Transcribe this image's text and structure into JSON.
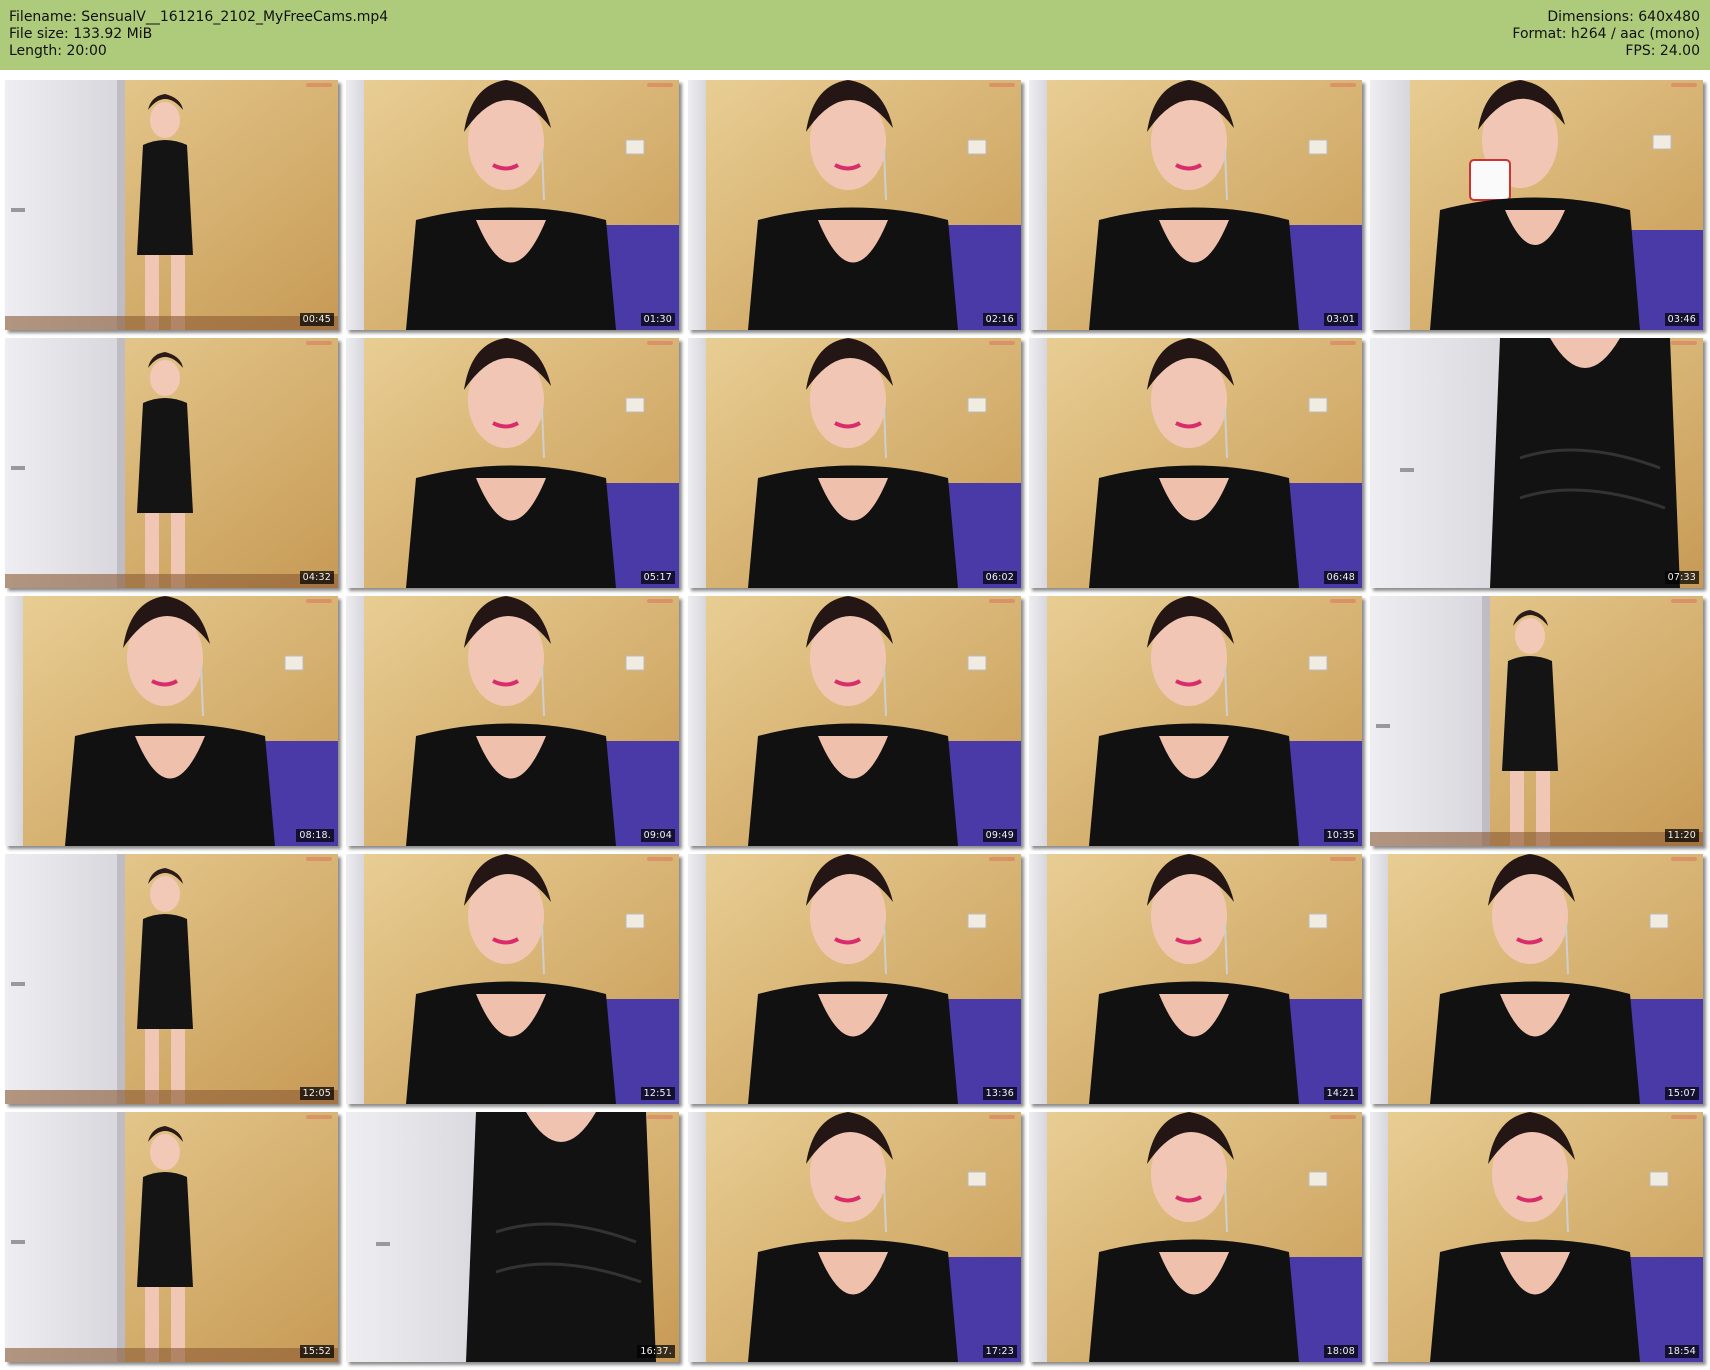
{
  "header": {
    "filename": "Filename: SensualV__161216_2102_MyFreeCams.mp4",
    "filesize": "File size: 133.92 MiB",
    "length": "Length: 20:00",
    "dimensions": "Dimensions: 640x480",
    "format": "Format: h264 / aac (mono)",
    "fps": "FPS: 24.00",
    "background_color": "#aecb7c"
  },
  "thumbnails": [
    {
      "timestamp": "00:45",
      "scene": "door-full"
    },
    {
      "timestamp": "01:30",
      "scene": "closeup-sofa"
    },
    {
      "timestamp": "02:16",
      "scene": "closeup-sofa"
    },
    {
      "timestamp": "03:01",
      "scene": "closeup-sofa"
    },
    {
      "timestamp": "03:46",
      "scene": "closeup-mug"
    },
    {
      "timestamp": "04:32",
      "scene": "door-full"
    },
    {
      "timestamp": "05:17",
      "scene": "closeup-sofa"
    },
    {
      "timestamp": "06:02",
      "scene": "closeup-sofa"
    },
    {
      "timestamp": "06:48",
      "scene": "closeup-sofa"
    },
    {
      "timestamp": "07:33",
      "scene": "door-torso"
    },
    {
      "timestamp": "08:18.",
      "scene": "closeup-sofa"
    },
    {
      "timestamp": "09:04",
      "scene": "closeup-sofa"
    },
    {
      "timestamp": "09:49",
      "scene": "closeup-sofa"
    },
    {
      "timestamp": "10:35",
      "scene": "closeup-sofa"
    },
    {
      "timestamp": "11:20",
      "scene": "door-full"
    },
    {
      "timestamp": "12:05",
      "scene": "door-full"
    },
    {
      "timestamp": "12:51",
      "scene": "closeup-sofa"
    },
    {
      "timestamp": "13:36",
      "scene": "closeup-sofa"
    },
    {
      "timestamp": "14:21",
      "scene": "closeup-sofa"
    },
    {
      "timestamp": "15:07",
      "scene": "closeup-sofa"
    },
    {
      "timestamp": "15:52",
      "scene": "door-full"
    },
    {
      "timestamp": "16:37.",
      "scene": "door-torso"
    },
    {
      "timestamp": "17:23",
      "scene": "closeup-sofa"
    },
    {
      "timestamp": "18:08",
      "scene": "closeup-sofa"
    },
    {
      "timestamp": "18:54",
      "scene": "closeup-sofa"
    }
  ]
}
